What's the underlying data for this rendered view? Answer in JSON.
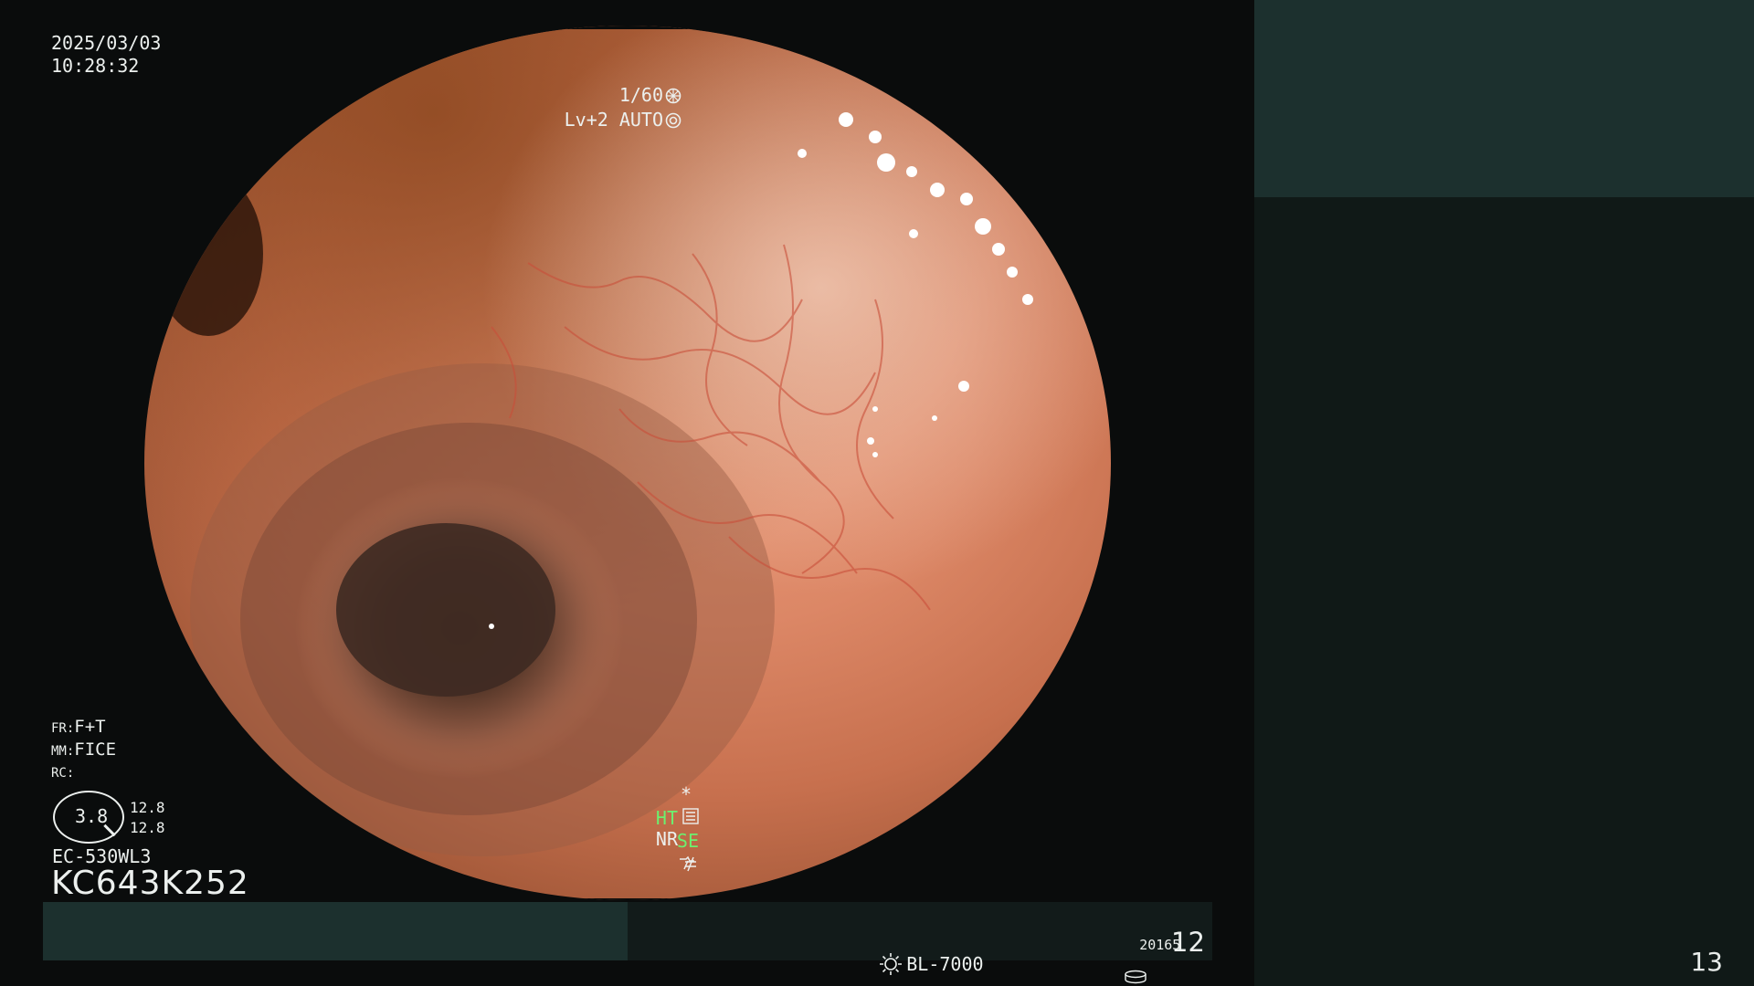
{
  "overlay": {
    "date": "2025/03/03",
    "time": "10:28:32",
    "shutter": "1/60",
    "iris": "Lv+2 AUTO",
    "fr_key": "FR:",
    "fr_value": "F+T",
    "mm_key": "MM:",
    "mm_value": "FICE",
    "rc_key": "RC:",
    "gauge_value": "3.8",
    "gauge_upper": "12.8",
    "gauge_lower": "12.8",
    "scope_model": "EC-530WL3",
    "serial": "KC643K252",
    "star": "*",
    "ht": "HT",
    "nr": "NR",
    "se": "SE"
  },
  "status_bar": {
    "light_source": "BL-7000",
    "counter": "20165",
    "frame_number": "12"
  },
  "side_panel": {
    "page_number": "13"
  },
  "icons": {
    "shutter": "aperture-icon",
    "iris": "iris-auto-icon",
    "settings": "settings-list-icon",
    "se": "structure-enhance-icon",
    "not_equal": "not-equal-icon",
    "light": "light-source-icon",
    "counter": "disk-counter-icon"
  },
  "colors": {
    "background": "#0a0c0c",
    "side_panel": "#101917",
    "side_block": "#1c302e",
    "overlay_text": "#ecf0ee",
    "status_green": "#6cf06f",
    "mucosa": "#dc8766"
  }
}
